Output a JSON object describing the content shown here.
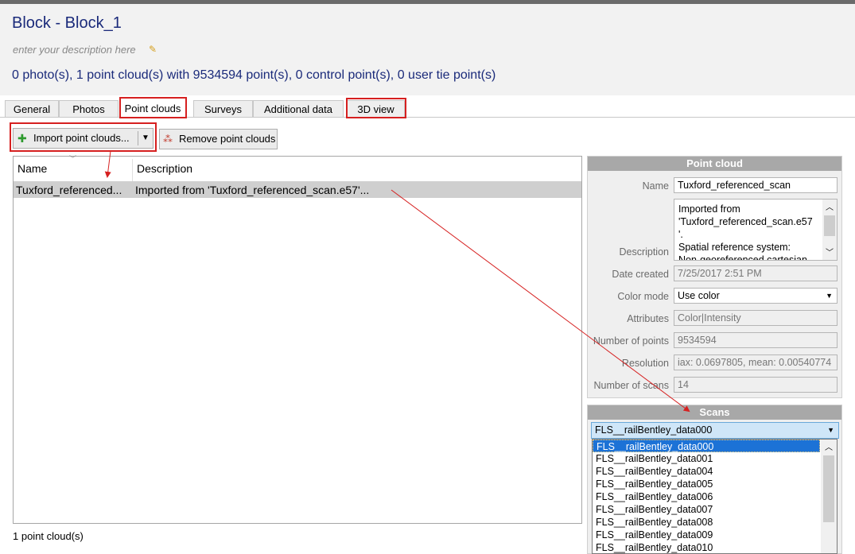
{
  "header": {
    "title": "Block - Block_1",
    "description_placeholder": "enter your description here",
    "summary": "0 photo(s), 1 point cloud(s) with 9534594 point(s), 0 control point(s), 0 user tie point(s)"
  },
  "tabs": [
    {
      "label": "General"
    },
    {
      "label": "Photos"
    },
    {
      "label": "Point clouds"
    },
    {
      "label": "Surveys"
    },
    {
      "label": "Additional data"
    },
    {
      "label": "3D view"
    }
  ],
  "toolbar": {
    "import_label": "Import point clouds...",
    "remove_label": "Remove point clouds"
  },
  "list": {
    "columns": [
      "Name",
      "Description"
    ],
    "rows": [
      {
        "name": "Tuxford_referenced...",
        "description": "Imported from 'Tuxford_referenced_scan.e57'..."
      }
    ],
    "status": "1 point cloud(s)"
  },
  "point_cloud_panel": {
    "title": "Point cloud",
    "name_label": "Name",
    "name_value": "Tuxford_referenced_scan",
    "description_label": "Description",
    "description_lines": [
      "Imported from",
      "'Tuxford_referenced_scan.e57",
      "'.",
      "Spatial reference system:",
      "Non-georeferenced cartesian"
    ],
    "date_label": "Date created",
    "date_value": "7/25/2017 2:51 PM",
    "color_mode_label": "Color mode",
    "color_mode_value": "Use color",
    "attributes_label": "Attributes",
    "attributes_value": "Color|Intensity",
    "num_points_label": "Number of points",
    "num_points_value": "9534594",
    "resolution_label": "Resolution",
    "resolution_value": "iax: 0.0697805, mean: 0.00540774",
    "num_scans_label": "Number of scans",
    "num_scans_value": "14"
  },
  "scans_panel": {
    "title": "Scans",
    "selected": "FLS__railBentley_data000",
    "items": [
      "FLS__railBentley_data000",
      "FLS__railBentley_data001",
      "FLS__railBentley_data004",
      "FLS__railBentley_data005",
      "FLS__railBentley_data006",
      "FLS__railBentley_data007",
      "FLS__railBentley_data008",
      "FLS__railBentley_data009",
      "FLS__railBentley_data010"
    ]
  },
  "colors": {
    "title_text": "#1a2a7a",
    "annotation_red": "#d62020",
    "selection_blue": "#1c72d6",
    "panel_header": "#a8a8a8"
  }
}
